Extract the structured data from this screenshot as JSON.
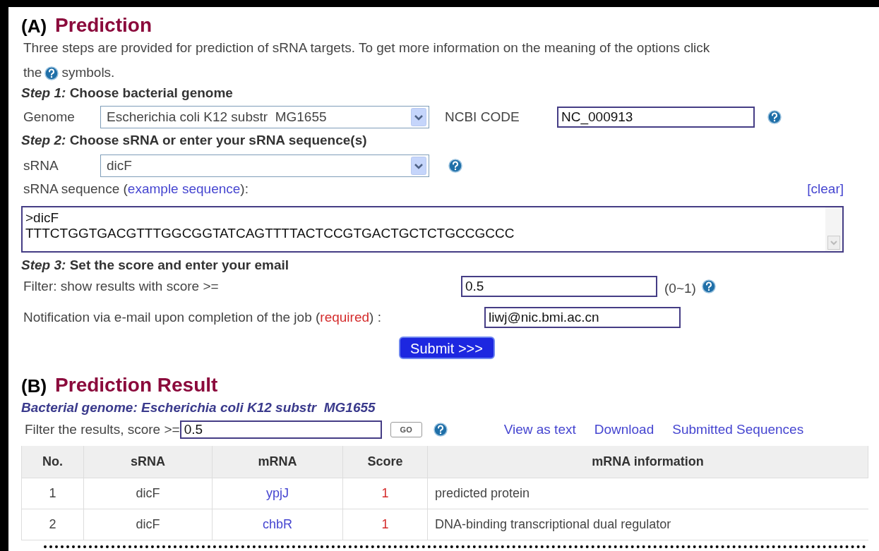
{
  "section_a": {
    "label": "(A)",
    "title": "Prediction",
    "intro_line_1": "Three steps are provided for prediction of sRNA targets. To get more information on the meaning of the options click",
    "intro_line_2_before": "the",
    "intro_line_2_after": "symbols."
  },
  "step_1": {
    "heading": "*Step 1:* Choose bacterial genome",
    "genome_label": "Genome",
    "genome_value": "Escherichia coli K12 substr  MG1655",
    "ncbi_label": "NCBI CODE",
    "ncbi_value": "NC_000913"
  },
  "step_2": {
    "heading": "*Step 2:* Choose sRNA or enter your sRNA sequence(s)",
    "srna_label": "sRNA",
    "srna_value": "dicF",
    "sequence_label_before": "sRNA sequence (",
    "sequence_link": "example sequence",
    "sequence_label_after": "):",
    "clear_link": "[clear]",
    "sequence_lines": [
      ">dicF",
      "TTTCTGGTGACGTTTGGCGGTATCAGTTTTACTCCGTGACTGCTCTGCCGCCC"
    ]
  },
  "step_3": {
    "heading": "*Step 3:* Set the score and enter your email",
    "filter_label": "Filter: show results with score >=",
    "filter_value": "0.5",
    "filter_range": "(0~1)",
    "email_label_before": "Notification via e-mail upon completion of the job (",
    "email_required": "required",
    "email_label_after": ") :",
    "email_value": "liwj@nic.bmi.ac.cn",
    "submit": "Submit >>>"
  },
  "section_b": {
    "label": "(B)",
    "title": "Prediction Result",
    "genome_line": "Bacterial genome: Escherichia coli K12 substr  MG1655",
    "filter_label": "Filter the results, score >=",
    "filter_value": "0.5",
    "go": "GO",
    "links": [
      "View as text",
      "Download",
      "Submitted Sequences"
    ]
  },
  "table": {
    "columns": [
      "No.",
      "sRNA",
      "mRNA",
      "Score",
      "mRNA information"
    ],
    "rows": [
      {
        "no": "1",
        "srna": "dicF",
        "mrna": "ypjJ",
        "score": "1",
        "info": "predicted protein"
      },
      {
        "no": "2",
        "srna": "dicF",
        "mrna": "chbR",
        "score": "1",
        "info": "DNA-binding transcriptional dual regulator"
      }
    ]
  }
}
